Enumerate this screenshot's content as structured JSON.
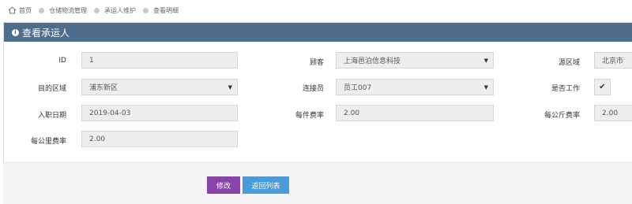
{
  "breadcrumb": {
    "items": [
      "首页",
      "仓储物流管理",
      "承运人维护",
      "查看明细"
    ]
  },
  "panel": {
    "title": "查看承运人"
  },
  "form": {
    "id": {
      "label": "ID",
      "value": "1"
    },
    "customer": {
      "label": "顾客",
      "value": "上海邑泊信息科技"
    },
    "source_region": {
      "label": "源区域",
      "value": "北京市"
    },
    "target_region": {
      "label": "目的区域",
      "value": "浦东新区"
    },
    "liaison": {
      "label": "连接员",
      "value": "员工007"
    },
    "is_working": {
      "label": "是否工作",
      "checked": true
    },
    "hire_date": {
      "label": "入职日期",
      "value": "2019-04-03"
    },
    "per_item_rate": {
      "label": "每件费率",
      "value": "2.00"
    },
    "per_kg_rate": {
      "label": "每公斤费率",
      "value": "2.00"
    },
    "per_km_rate": {
      "label": "每公里费率",
      "value": "2.00"
    }
  },
  "buttons": {
    "edit": "修改",
    "back": "返回列表"
  },
  "icons": {
    "home": "home-icon",
    "header": "info-circle-icon",
    "select_caret": "caret-down-icon",
    "checkbox": "checkmark-icon"
  }
}
